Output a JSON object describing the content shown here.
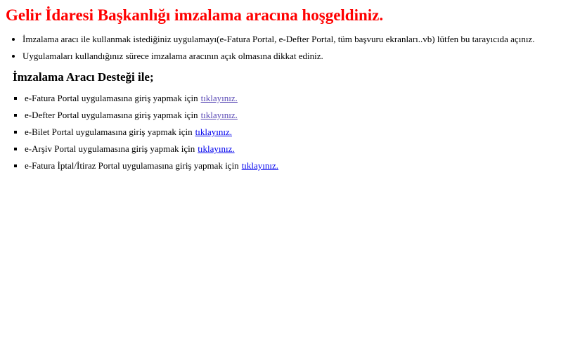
{
  "page": {
    "title": "Gelir İdaresi Başkanlığı imzalama aracına hoşgeldiniz.",
    "title_color": "#ff0000"
  },
  "info_list": {
    "items": [
      "İmzalama aracı ile kullanmak istediğiniz uygulamayı(e-Fatura Portal, e-Defter Portal, tüm başvuru ekranları..vb) lütfen bu tarayıcıda açınız.",
      "Uygulamaları kullandığınız sürece imzalama aracının açık olmasına dikkat ediniz."
    ]
  },
  "section": {
    "heading": "İmzalama Aracı Desteği ile;"
  },
  "portal_list": {
    "link_color_unvisited": "#0000ee",
    "link_color_visited": "#5a4ab5",
    "items": [
      {
        "text": "e-Fatura Portal uygulamasına giriş yapmak için",
        "link_label": "tıklayınız.",
        "visited": true
      },
      {
        "text": "e-Defter Portal uygulamasına giriş yapmak için",
        "link_label": "tıklayınız.",
        "visited": true
      },
      {
        "text": "e-Bilet Portal uygulamasına giriş yapmak için",
        "link_label": "tıklayınız.",
        "visited": false
      },
      {
        "text": "e-Arşiv Portal uygulamasına giriş yapmak için",
        "link_label": "tıklayınız.",
        "visited": false
      },
      {
        "text": "e-Fatura İptal/İtiraz Portal uygulamasına giriş yapmak için",
        "link_label": "tıklayınız.",
        "visited": false
      }
    ]
  }
}
